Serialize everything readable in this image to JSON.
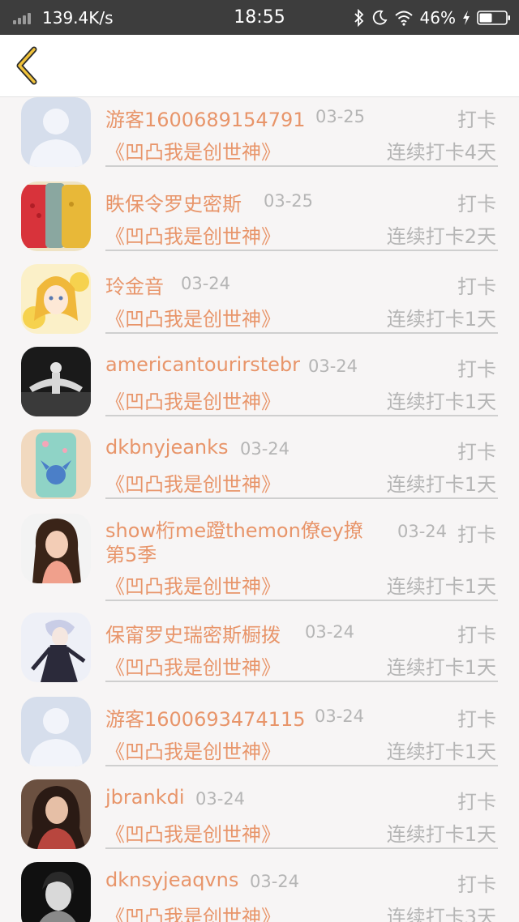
{
  "status_bar": {
    "network_speed": "139.4K/s",
    "time": "18:55",
    "battery": "46%",
    "icons": [
      "signal-icon",
      "bluetooth-icon",
      "moon-icon",
      "wifi-icon",
      "charging-icon",
      "battery-icon"
    ]
  },
  "header": {
    "back_icon": "chevron-left-icon",
    "accent_color": "#f0c23a"
  },
  "colors": {
    "name_accent": "#e8956a",
    "muted_text": "#b5b5b5",
    "background": "#f7f5f5"
  },
  "checkins": [
    {
      "name": "游客1600689154791",
      "date": "03-25",
      "action": "打卡",
      "book": "《凹凸我是创世神》",
      "streak": "连续打卡4天",
      "avatar": "default-avatar"
    },
    {
      "name": "眣保令罗史密斯",
      "date": "03-25",
      "action": "打卡",
      "book": "《凹凸我是创世神》",
      "streak": "连续打卡2天",
      "avatar": "phones-avatar"
    },
    {
      "name": "玲金音",
      "date": "03-24",
      "action": "打卡",
      "book": "《凹凸我是创世神》",
      "streak": "连续打卡1天",
      "avatar": "anime-girl-avatar"
    },
    {
      "name": "americantourirstebr",
      "date": "03-24",
      "action": "打卡",
      "book": "《凹凸我是创世神》",
      "streak": "连续打卡1天",
      "avatar": "dancer-avatar"
    },
    {
      "name": "dkbnyjeanks",
      "date": "03-24",
      "action": "打卡",
      "book": "《凹凸我是创世神》",
      "streak": "连续打卡1天",
      "avatar": "phone-case-avatar"
    },
    {
      "name": "show桁me蹬themon僚ey撩第5季",
      "date": "03-24",
      "action": "打卡",
      "book": "《凹凸我是创世神》",
      "streak": "连续打卡1天",
      "avatar": "woman-avatar"
    },
    {
      "name": "保甯罗史瑞密斯橱拨",
      "date": "03-24",
      "action": "打卡",
      "book": "《凹凸我是创世神》",
      "streak": "连续打卡1天",
      "avatar": "anime-boy-avatar"
    },
    {
      "name": "游客1600693474115",
      "date": "03-24",
      "action": "打卡",
      "book": "《凹凸我是创世神》",
      "streak": "连续打卡1天",
      "avatar": "default-avatar"
    },
    {
      "name": "jbrankdi",
      "date": "03-24",
      "action": "打卡",
      "book": "《凹凸我是创世神》",
      "streak": "连续打卡1天",
      "avatar": "portrait-avatar"
    },
    {
      "name": "dknsyjeaqvns",
      "date": "03-24",
      "action": "打卡",
      "book": "《凹凸我是创世神》",
      "streak": "连续打卡3天",
      "avatar": "dark-portrait-avatar"
    }
  ]
}
